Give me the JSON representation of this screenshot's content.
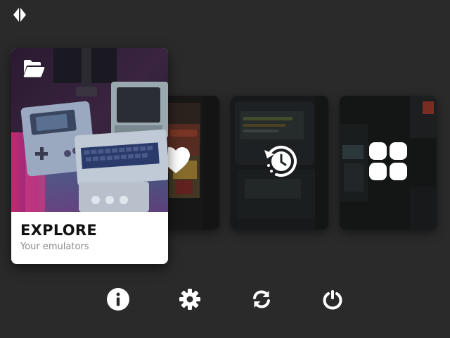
{
  "app": {
    "logo_icon": "diamond-logo-icon"
  },
  "cards": {
    "explore": {
      "title": "EXPLORE",
      "subtitle": "Your emulators",
      "icon": "folder-open-icon"
    },
    "favorites": {
      "icon": "heart-icon"
    },
    "history": {
      "icon": "history-clock-icon"
    },
    "apps": {
      "icon": "apps-grid-icon"
    }
  },
  "toolbar": {
    "buttons": [
      {
        "name": "info",
        "icon": "info-icon"
      },
      {
        "name": "settings",
        "icon": "gear-icon"
      },
      {
        "name": "update",
        "icon": "refresh-icon"
      },
      {
        "name": "power",
        "icon": "power-icon"
      }
    ]
  },
  "colors": {
    "background": "#2a2a2a",
    "card_label_bg": "#ffffff",
    "title_text": "#111111",
    "subtitle_text": "#8a8a8a",
    "icon": "#ffffff"
  }
}
